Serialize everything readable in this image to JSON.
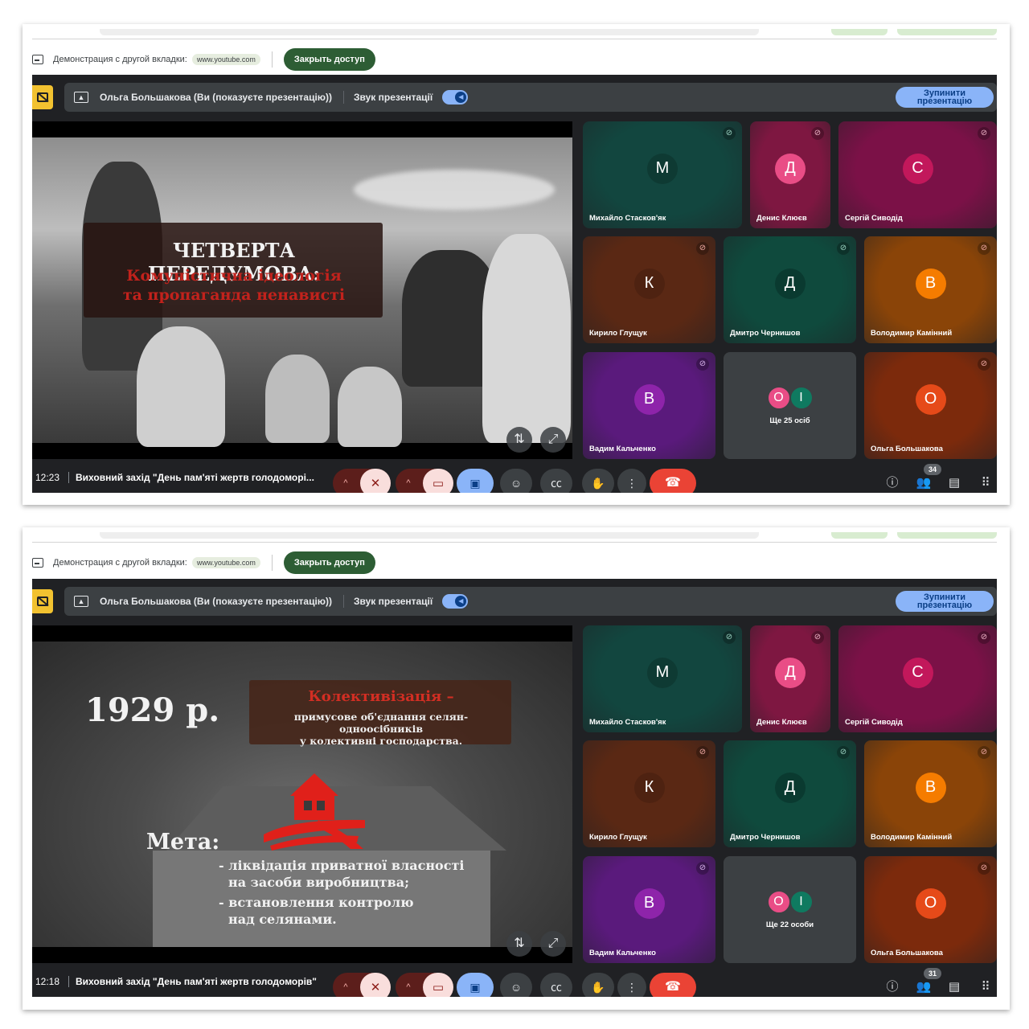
{
  "share_bar": {
    "label": "Демонстрация с другой вкладки:",
    "url": "www.youtube.com",
    "stop_button": "Закрыть доступ"
  },
  "presentation_bar": {
    "presenter": "Ольга Большакова (Ви (показуєте презентацію))",
    "audio_label": "Звук презентації",
    "stop_button_line1": "Зупинити",
    "stop_button_line2": "презентацію"
  },
  "participants": [
    {
      "name": "Михайло Стасков'як",
      "initial": "М",
      "tile_color": "#12463f",
      "avatar_color": "#0e3a33",
      "mute_color": "#9fd8c6",
      "muted": true
    },
    {
      "name": "Денис Клюєв",
      "initial": "Д",
      "tile_color": "#7e1741",
      "avatar_color": "#e94d86",
      "mute_color": "#f2b8cb",
      "muted": true
    },
    {
      "name": "Сергій Сиводід",
      "initial": "С",
      "tile_color": "#7b1147",
      "avatar_color": "#c2185b",
      "mute_color": "#f2b8cb",
      "muted": true
    },
    {
      "name": "Кирило Глущук",
      "initial": "К",
      "tile_color": "#5a2814",
      "avatar_color": "#4e2211",
      "mute_color": "#f6aea9",
      "muted": true
    },
    {
      "name": "Дмитро Чернишов",
      "initial": "Д",
      "tile_color": "#0f4a3d",
      "avatar_color": "#0a3a30",
      "mute_color": "#9fd8c6",
      "muted": true
    },
    {
      "name": "Володимир Камінний",
      "initial": "В",
      "tile_color": "#8a4408",
      "avatar_color": "#f57c00",
      "mute_color": "#f6aea9",
      "muted": true
    },
    {
      "name": "Вадим Кальченко",
      "initial": "В",
      "tile_color": "#5a1a7c",
      "avatar_color": "#8e24aa",
      "mute_color": "#dcb8f0",
      "muted": true
    },
    {
      "name": "Ольга Большакова",
      "initial": "О",
      "tile_color": "#7c2a0c",
      "avatar_color": "#e64a19",
      "mute_color": "#f6aea9",
      "muted": true
    }
  ],
  "others_avatars": [
    {
      "initial": "О",
      "color": "#e94d86"
    },
    {
      "initial": "І",
      "color": "#0f7a60"
    }
  ],
  "screens": [
    {
      "time": "12:23",
      "meeting_name": "Виховний захід \"День пам'яті жертв голодоморі...",
      "others_label": "Ще 25 осіб",
      "people_count": "34",
      "slide": {
        "title": "ЧЕТВЕРТА ПЕРЕДУМОВА:",
        "subtitle_line1": "Комуністична ідеологія",
        "subtitle_line2": "та пропаганда ненависті"
      }
    },
    {
      "time": "12:18",
      "meeting_name": "Виховний захід \"День пам'яті жертв голодоморів\"",
      "others_label": "Ще 22 особи",
      "people_count": "31",
      "slide": {
        "year": "1929 р.",
        "def_title": "Колективізація –",
        "def_line1": "примусове об'єднання селян-одноосібників",
        "def_line2": "у колективні господарства.",
        "goal_title": "Мета:",
        "goal_item1_line1": "- ліквідація приватної власності",
        "goal_item1_line2": "на засоби виробництва;",
        "goal_item2_line1": "- встановлення контролю",
        "goal_item2_line2": "над селянами."
      }
    }
  ],
  "icons": {
    "share": "tab-share-icon",
    "mic_off": "mic-off-icon",
    "cam_off": "camera-off-icon",
    "present": "present-screen-icon",
    "emoji": "emoji-icon",
    "captions": "captions-icon",
    "hand": "raise-hand-icon",
    "more": "more-vert-icon",
    "hangup": "hang-up-icon",
    "info": "info-icon",
    "people": "people-icon",
    "chat": "chat-icon",
    "apps": "apps-grid-icon"
  }
}
